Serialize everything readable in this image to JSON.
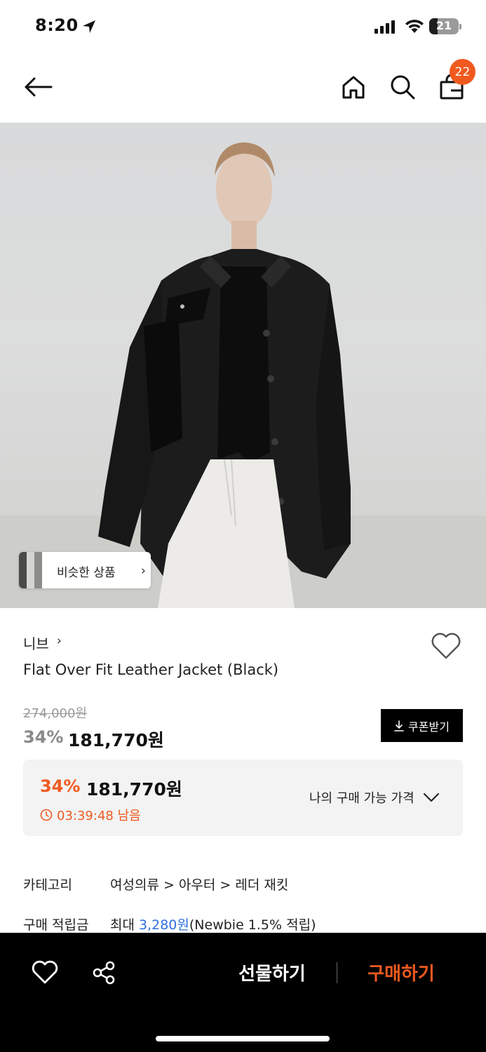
{
  "status_bar": {
    "time": "8:20",
    "battery": "21"
  },
  "header": {
    "cart_count": "22",
    "icons": [
      "back-arrow-icon",
      "home-icon",
      "search-icon",
      "cart-bag-icon"
    ]
  },
  "hero": {
    "similar_label": "비슷한 상품",
    "similar_chevron": "›"
  },
  "product": {
    "brand": "니브",
    "brand_chevron": "›",
    "title": "Flat Over Fit Leather Jacket (Black)",
    "original_price": "274,000원",
    "discount_rate": "34%",
    "sale_price": "181,770원",
    "coupon_label": "쿠폰받기"
  },
  "my_price": {
    "discount_rate": "34%",
    "price": "181,770원",
    "timer": "03:39:48 남음",
    "toggle_label": "나의 구매 가능 가격"
  },
  "info": {
    "category_label": "카테고리",
    "category_path": "여성의류 > 아우터 > 레더 재킷",
    "points_label": "구매 적립금",
    "points_prefix": "최대 ",
    "points_amount": "3,280원",
    "points_suffix": "(Newbie 1.5% 적립)"
  },
  "bottom_bar": {
    "gift_label": "선물하기",
    "buy_label": "구매하기"
  },
  "colors": {
    "accent": "#f05a1f",
    "link": "#2f6fe0",
    "bar": "#000000"
  }
}
